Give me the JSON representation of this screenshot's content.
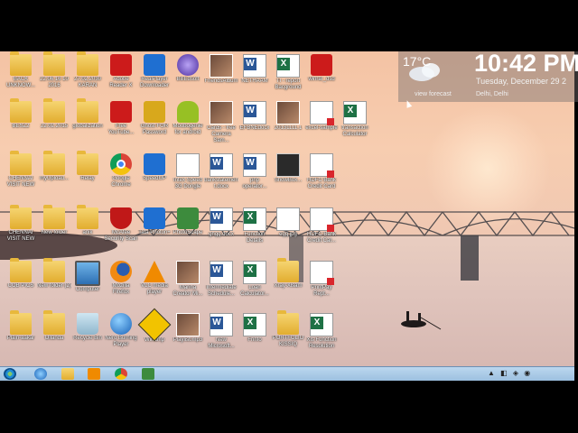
{
  "weather": {
    "temperature": "17°C",
    "link": "view forecast",
    "city": "Delhi, Delhi"
  },
  "clock": {
    "time": "10:42 PM",
    "date": "Tuesday, December 29 2"
  },
  "taskbar": {
    "tray": "▲ ◧ ◈ ◉"
  },
  "icons": [
    {
      "label": "BACK UNKNOW...",
      "icon": "folder-icon"
    },
    {
      "label": "22.06.16 10 2016",
      "icon": "folder-icon"
    },
    {
      "label": "27.02.2030 KARAN",
      "icon": "folder-icon"
    },
    {
      "label": "Adobe Reader X",
      "icon": "pdf-reader-icon"
    },
    {
      "label": "RealPlayer Downloader",
      "icon": "app-icon"
    },
    {
      "label": "BBEdsoft",
      "icon": "purple-app-icon"
    },
    {
      "label": "FriendsAlbum",
      "icon": "photo-icon"
    },
    {
      "label": "NETHAAM",
      "icon": "word-icon"
    },
    {
      "label": "TI - report Bacground",
      "icon": "excel-icon"
    },
    {
      "label": "winrar_dsd",
      "icon": "winrar-icon"
    },
    {
      "label": "BESZ2",
      "icon": "folder-icon"
    },
    {
      "label": "22.02.2015",
      "icon": "folder-icon"
    },
    {
      "label": "globalization",
      "icon": "folder-icon"
    },
    {
      "label": "Free YouTube...",
      "icon": "download-icon"
    },
    {
      "label": "Ghost FOR Password",
      "icon": "lock-icon"
    },
    {
      "label": "Moobogenie for android",
      "icon": "android-icon"
    },
    {
      "label": "Cards - free Camera Sam...",
      "icon": "photo-icon"
    },
    {
      "label": "EFBNEdocx",
      "icon": "word-icon"
    },
    {
      "label": "20131111.1",
      "icon": "photo-icon"
    },
    {
      "label": "excel-sample",
      "icon": "pdf-icon"
    },
    {
      "label": "transaction Calculator",
      "icon": "excel-icon"
    },
    {
      "label": "CHENNAI VISIT NEW",
      "icon": "folder-icon"
    },
    {
      "label": "myUpload...",
      "icon": "folder-icon"
    },
    {
      "label": "Relay",
      "icon": "folder-icon"
    },
    {
      "label": "Google Chrome",
      "icon": "chrome-icon"
    },
    {
      "label": "SpeedUP",
      "icon": "app-icon"
    },
    {
      "label": "Intex Speed 3G Dongle",
      "icon": "intex-icon"
    },
    {
      "label": "bankstatement.docx",
      "icon": "word-icon"
    },
    {
      "label": "php operator...",
      "icon": "word-icon"
    },
    {
      "label": "ShowBox...",
      "icon": "dark-icon"
    },
    {
      "label": "HDFC Bank Credit Card",
      "icon": "pdf-icon"
    },
    {
      "label": "CHENNAI VISIT NEW",
      "icon": "folder-icon"
    },
    {
      "label": "New folder",
      "icon": "folder-icon"
    },
    {
      "label": "anik",
      "icon": "folder-icon"
    },
    {
      "label": "McAfee Security Scan",
      "icon": "mcafee-icon"
    },
    {
      "label": "Tata Photon+",
      "icon": "app-icon"
    },
    {
      "label": "PhotoScape",
      "icon": "photoscape-icon"
    },
    {
      "label": "ghgg.docx",
      "icon": "word-icon"
    },
    {
      "label": "Function Details",
      "icon": "excel-icon"
    },
    {
      "label": "egg.jpg",
      "icon": "turn-icon"
    },
    {
      "label": "HDFC Bank Credit Car...",
      "icon": "pdf-icon"
    },
    {
      "label": "COB PICS",
      "icon": "folder-icon"
    },
    {
      "label": "New folder (2)",
      "icon": "folder-icon"
    },
    {
      "label": "Computer",
      "icon": "computer-icon"
    },
    {
      "label": "Mozilla Firefox",
      "icon": "firefox-icon"
    },
    {
      "label": "VLC media player",
      "icon": "vlc-icon"
    },
    {
      "label": "Marina Creator Mi...",
      "icon": "photo-icon"
    },
    {
      "label": "Intermediate Schedule...",
      "icon": "word-icon"
    },
    {
      "label": "Loan Calculator...",
      "icon": "excel-icon"
    },
    {
      "label": "Xray-Xlsam",
      "icon": "folder-icon"
    },
    {
      "label": "PrintPay Rept...",
      "icon": "pdf-icon"
    },
    {
      "label": "Plain-aakar",
      "icon": "folder-icon"
    },
    {
      "label": "Ollanda",
      "icon": "folder-icon"
    },
    {
      "label": "Recycle Bin",
      "icon": "recycle-bin-icon"
    },
    {
      "label": "Nero Burning Player",
      "icon": "globe-icon"
    },
    {
      "label": "Winamp",
      "icon": "winamp-icon"
    },
    {
      "label": "Playlist.mp3",
      "icon": "photo-icon"
    },
    {
      "label": "New Microsoft...",
      "icon": "word-icon"
    },
    {
      "label": "Frinfo",
      "icon": "excel-icon"
    },
    {
      "label": "PORTFOLIO KISSIQ",
      "icon": "folder-icon"
    },
    {
      "label": "Xls Function Resolution",
      "icon": "excel-icon"
    }
  ]
}
